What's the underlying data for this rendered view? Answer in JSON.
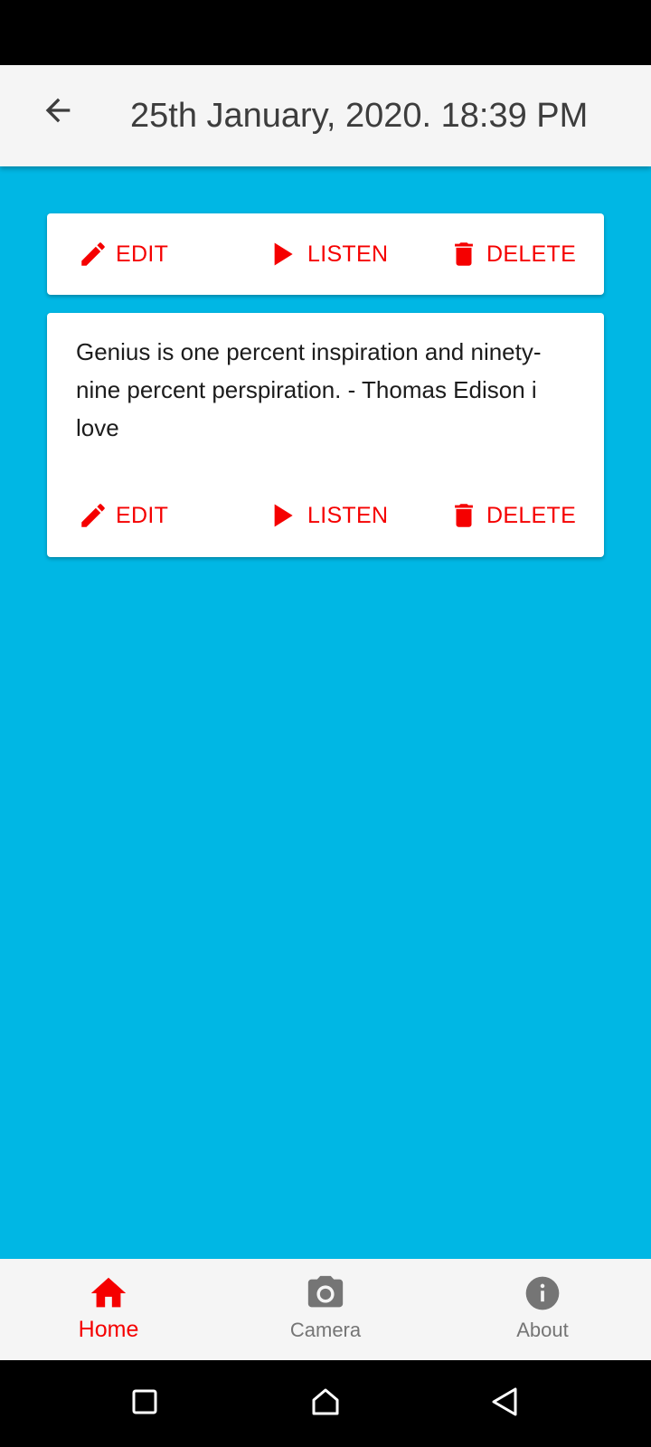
{
  "app_bar": {
    "title": "25th January, 2020. 18:39 PM",
    "back_icon": "arrow-back-icon"
  },
  "colors": {
    "background": "#00b7e4",
    "accent": "#f50000",
    "app_bar": "#f5f5f5",
    "card": "#ffffff",
    "inactive_nav": "#757575"
  },
  "cards": [
    {
      "text": "",
      "actions": {
        "edit_label": "EDIT",
        "listen_label": "LISTEN",
        "delete_label": "DELETE"
      }
    },
    {
      "text": "Genius is one percent inspiration and ninety-nine percent perspiration. - Thomas Edison i love",
      "actions": {
        "edit_label": "EDIT",
        "listen_label": "LISTEN",
        "delete_label": "DELETE"
      }
    }
  ],
  "icons": {
    "edit": "pencil-icon",
    "listen": "play-icon",
    "delete": "trash-icon",
    "home": "home-icon",
    "camera": "camera-icon",
    "about": "info-icon"
  },
  "bottom_nav": {
    "items": [
      {
        "label": "Home",
        "active": true
      },
      {
        "label": "Camera",
        "active": false
      },
      {
        "label": "About",
        "active": false
      }
    ]
  },
  "system_nav": {
    "recents_icon": "square-icon",
    "home_icon": "circle-home-icon",
    "back_icon": "triangle-back-icon"
  }
}
